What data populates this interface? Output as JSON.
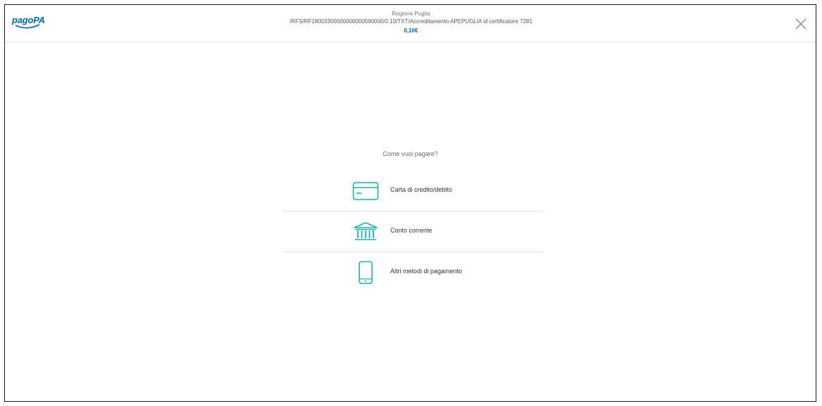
{
  "header": {
    "logo_text": "pagoPA",
    "organization": "Regione Puglia",
    "payment_reference": "/RFS/RF18003300000000000590000/0.10/TXT/Accreditamento APEPUGLIA id certificatore 7281",
    "amount": "0,10€"
  },
  "main": {
    "question": "Come vuoi pagare?",
    "methods": [
      {
        "label": "Carta di credito/debito",
        "icon": "credit-card-icon"
      },
      {
        "label": "Conto corrente",
        "icon": "bank-icon"
      },
      {
        "label": "Altri metodi di pagamento",
        "icon": "smartphone-icon"
      }
    ]
  },
  "colors": {
    "brand_blue": "#0066cc",
    "icon_teal": "#17b3b3",
    "divider": "#e4e4e4"
  }
}
